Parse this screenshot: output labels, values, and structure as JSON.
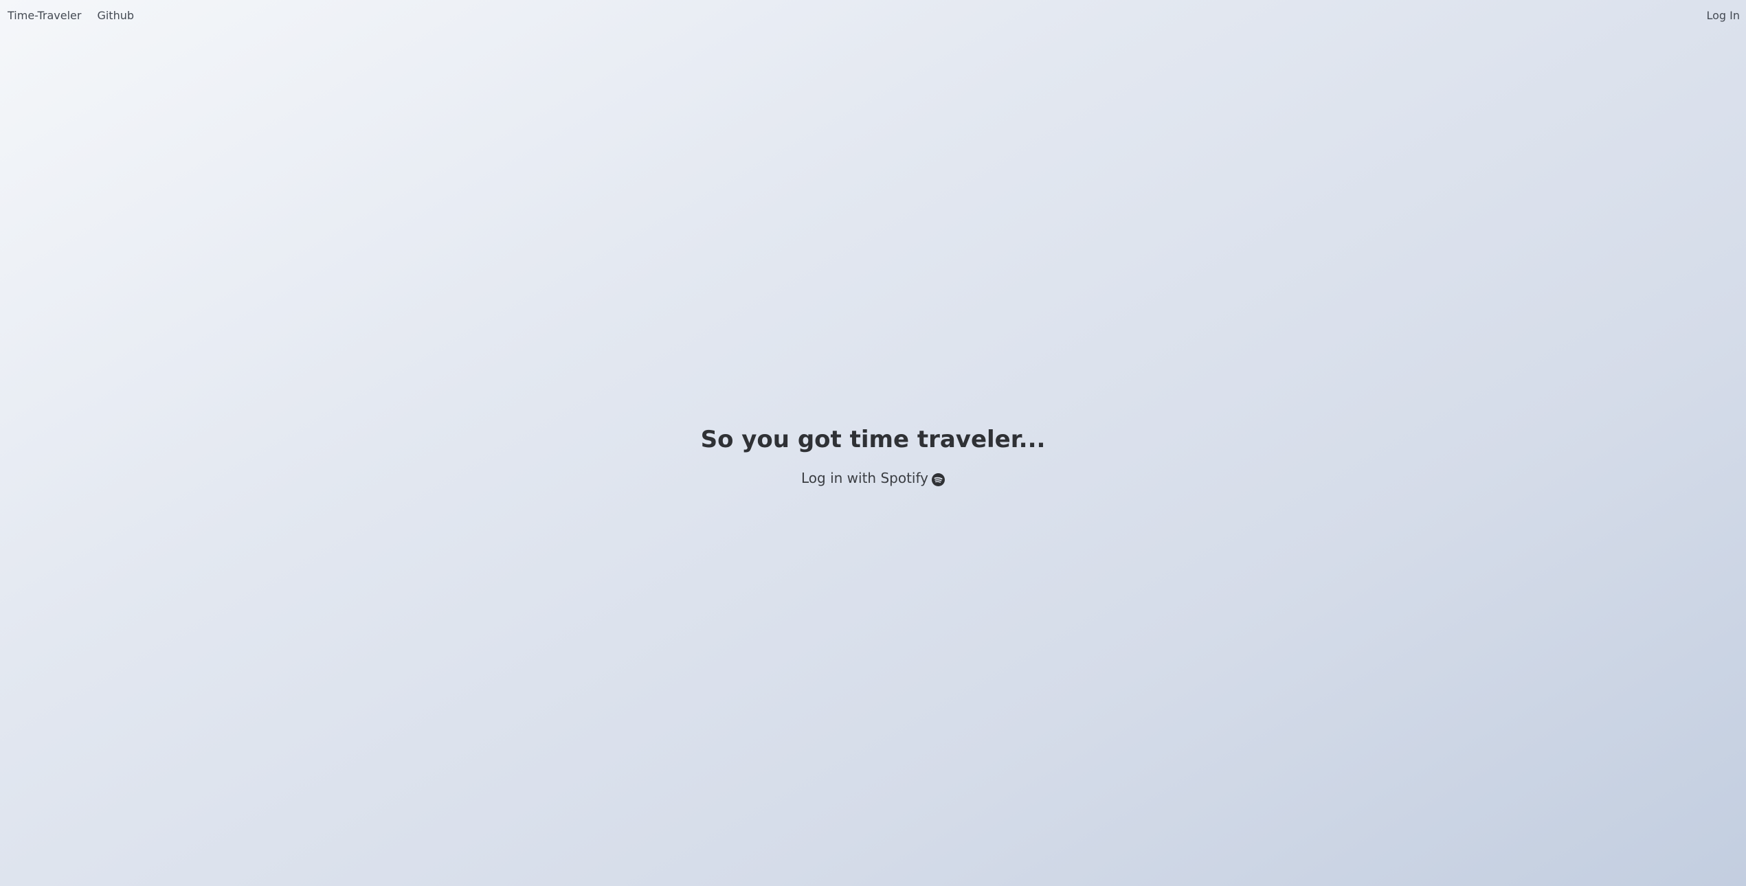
{
  "nav": {
    "brand": "Time-Traveler",
    "github": "Github",
    "login": "Log In"
  },
  "hero": {
    "title": "So you got time traveler...",
    "login_button": "Log in with Spotify",
    "login_icon": "spotify-icon"
  },
  "colors": {
    "background_start": "#f5f7fa",
    "background_end": "#c3cee0",
    "text": "#333333"
  }
}
